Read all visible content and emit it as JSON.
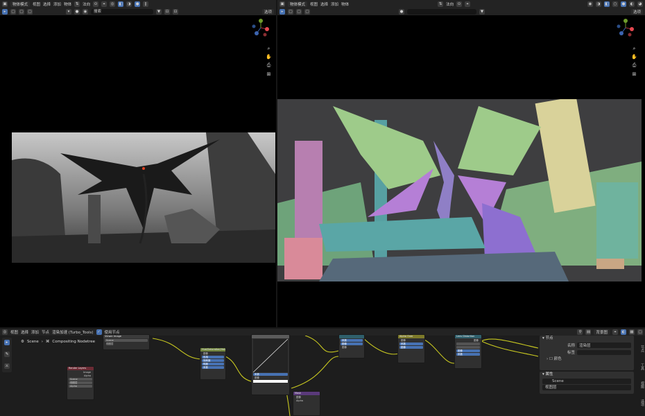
{
  "left_viewport": {
    "mode": "物体模式",
    "menus": [
      "视图",
      "选择",
      "添加",
      "物体"
    ],
    "orientation": "法向",
    "search_placeholder": "搜索",
    "select_label": "选项"
  },
  "right_viewport": {
    "mode": "物体模式",
    "menus": [
      "视图",
      "选择",
      "添加",
      "物体"
    ],
    "orientation": "法向",
    "select_label": "选项"
  },
  "node_editor": {
    "menus": [
      "视图",
      "选择",
      "添加",
      "节点"
    ],
    "render_accel": "渲染加速 (Turbo_Tools)",
    "use_nodes": "使用节点",
    "breadcrumb": [
      "Scene",
      "Compositing Nodetree"
    ],
    "backdrop_button": "背景图",
    "node_titles": [
      "Viewer Image",
      "Hue/Saturation/Value",
      "Alpha Over",
      "Lens Distortion",
      "Mask",
      "Render Layers"
    ],
    "node_rows": {
      "scene": "Scene",
      "layer": "视图层",
      "h": "色相",
      "s": "饱和度",
      "v": "明度",
      "fac": "系数",
      "alpha": "Alpha",
      "image": "图像",
      "image_out": "Image",
      "alpha_out": "Alpha"
    }
  },
  "side_panel": {
    "node_section": "节点",
    "name_label": "名称",
    "name_value": "渲染层",
    "label_label": "标签",
    "color_label": "颜色",
    "props_section": "属性",
    "scene_value": "Scene",
    "layer_value": "视图层",
    "tabs": [
      "节点",
      "工具",
      "视图",
      "选项"
    ]
  },
  "colors": {
    "accent": "#4772b3",
    "node_green": "#70843c",
    "node_purple": "#5a3a7a",
    "node_teal": "#2f5f6b",
    "node_red": "#6b2b34",
    "node_yellow": "#7d7a2a",
    "wire": "#c9c920"
  }
}
